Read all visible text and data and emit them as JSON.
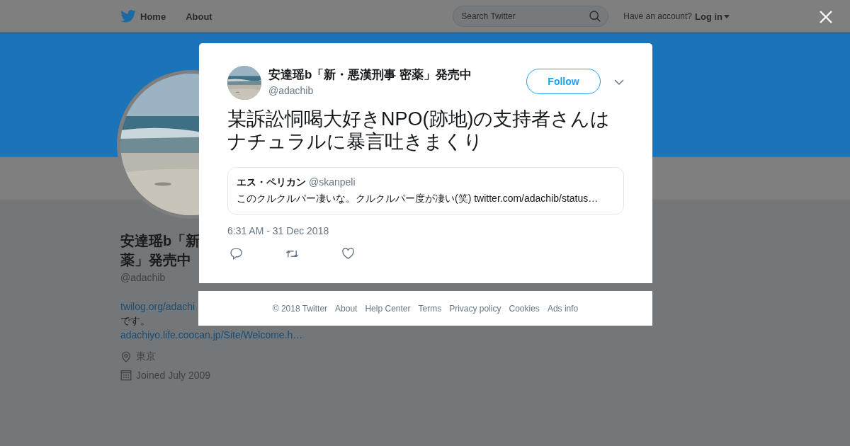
{
  "nav": {
    "links": [
      "Home",
      "About"
    ],
    "search": {
      "placeholder": "Search Twitter"
    },
    "account_prompt": "Have an account?",
    "login": "Log in"
  },
  "profile": {
    "name_line_1": "安達瑶b「新",
    "name_line_2": "薬」発売中",
    "handle": "@adachib",
    "bio": [
      {
        "kind": "link",
        "text": "twilog.org/adachi"
      },
      {
        "kind": "text",
        "text": "です。"
      },
      {
        "kind": "link",
        "text": "adachiyo.life.coocan.jp/Site/Welcome.h…"
      }
    ],
    "location": "東京",
    "joined": "Joined July 2009"
  },
  "tweet": {
    "author": {
      "name": "安達瑶b「新・悪漢刑事 密薬」発売中",
      "handle": "@adachib"
    },
    "follow_button": "Follow",
    "text": "某訴訟恫喝大好きNPO(跡地)の支持者さんはナチュラルに暴言吐きまくり",
    "quoted": {
      "name": "エス・ペリカン",
      "handle": "@skanpeli",
      "text": "このクルクルパー凄いな。クルクルパー度が凄い(笑) twitter.com/adachib/status…"
    },
    "timestamp": "6:31 AM - 31 Dec 2018"
  },
  "footer": {
    "copyright": "© 2018 Twitter",
    "links": [
      "About",
      "Help Center",
      "Terms",
      "Privacy policy",
      "Cookies",
      "Ads info"
    ]
  }
}
